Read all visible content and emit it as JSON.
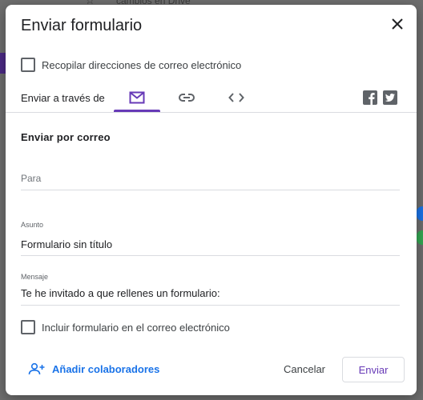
{
  "background": {
    "top_text": "cambios en Drive"
  },
  "dialog": {
    "title": "Enviar formulario",
    "collect_emails_label": "Recopilar direcciones de correo electrónico",
    "send_via_label": "Enviar a través de",
    "tabs": [
      {
        "icon": "mail-icon",
        "active": true
      },
      {
        "icon": "link-icon",
        "active": false
      },
      {
        "icon": "embed-code-icon",
        "active": false
      }
    ],
    "social": [
      "facebook-icon",
      "twitter-icon"
    ],
    "email_section": {
      "title": "Enviar por correo",
      "to_placeholder": "Para",
      "subject_label": "Asunto",
      "subject_value": "Formulario sin título",
      "message_label": "Mensaje",
      "message_value": "Te he invitado a que rellenes un formulario:",
      "include_form_label": "Incluir formulario en el correo electrónico"
    },
    "footer": {
      "add_collaborators": "Añadir colaboradores",
      "cancel": "Cancelar",
      "send": "Enviar"
    }
  },
  "colors": {
    "accent": "#673ab7",
    "link": "#1a73e8",
    "icon": "#5f6368"
  }
}
